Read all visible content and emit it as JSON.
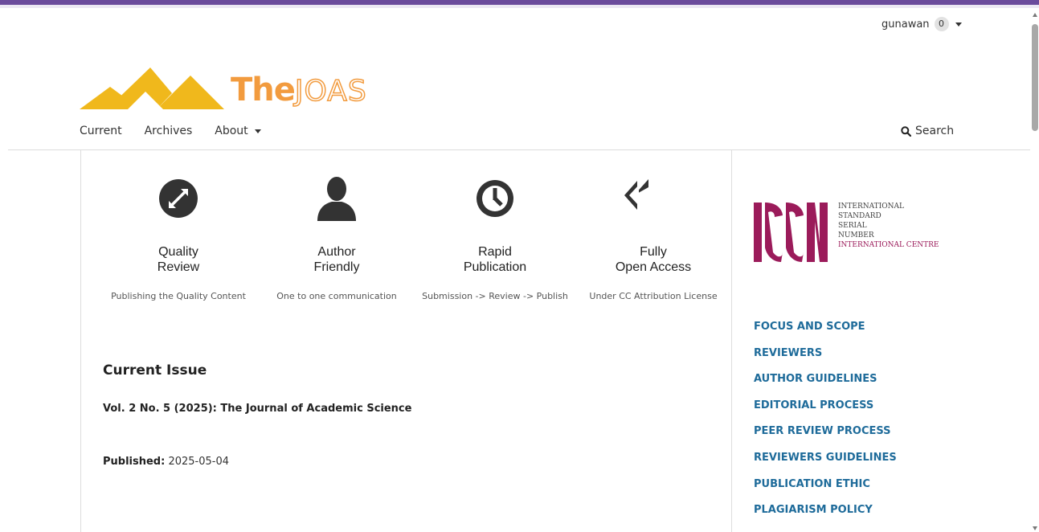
{
  "user": {
    "name": "gunawan",
    "notifications": "0"
  },
  "logo": {
    "brand_bold": "The",
    "brand_outline": "JOAS"
  },
  "nav": {
    "items": [
      "Current",
      "Archives",
      "About"
    ],
    "search_label": "Search"
  },
  "features": [
    {
      "title_line1": "Quality",
      "title_line2": "Review",
      "desc": "Publishing the Quality Content",
      "icon": "expand-arrows-icon"
    },
    {
      "title_line1": "Author",
      "title_line2": "Friendly",
      "desc": "One to one communication",
      "icon": "user-silhouette-icon"
    },
    {
      "title_line1": "Rapid",
      "title_line2": "Publication",
      "desc": "Submission -> Review -> Publish",
      "icon": "clock-icon"
    },
    {
      "title_line1": "Fully",
      "title_line2": "Open Access",
      "desc": "Under CC Attribution License",
      "icon": "reply-all-icon"
    }
  ],
  "current_issue": {
    "heading": "Current Issue",
    "issue_title": "Vol. 2 No. 5 (2025): The Journal of Academic Science",
    "published_label": "Published:",
    "published_date": "2025-05-04"
  },
  "issn": {
    "mark": "ISSN",
    "lines": [
      "INTERNATIONAL",
      "STANDARD",
      "SERIAL",
      "NUMBER"
    ],
    "line_red": "INTERNATIONAL CENTRE"
  },
  "sidebar_links": [
    "FOCUS AND SCOPE",
    "REVIEWERS",
    "AUTHOR GUIDELINES",
    "EDITORIAL PROCESS",
    "PEER REVIEW PROCESS",
    "REVIEWERS GUIDELINES",
    "PUBLICATION ETHIC",
    "PLAGIARISM POLICY"
  ],
  "colors": {
    "accent": "#6b4b9c",
    "logo_yellow": "#f0b81c",
    "logo_orange": "#f29b3e",
    "link": "#1e6b9a",
    "issn_red": "#9b1b5a"
  }
}
